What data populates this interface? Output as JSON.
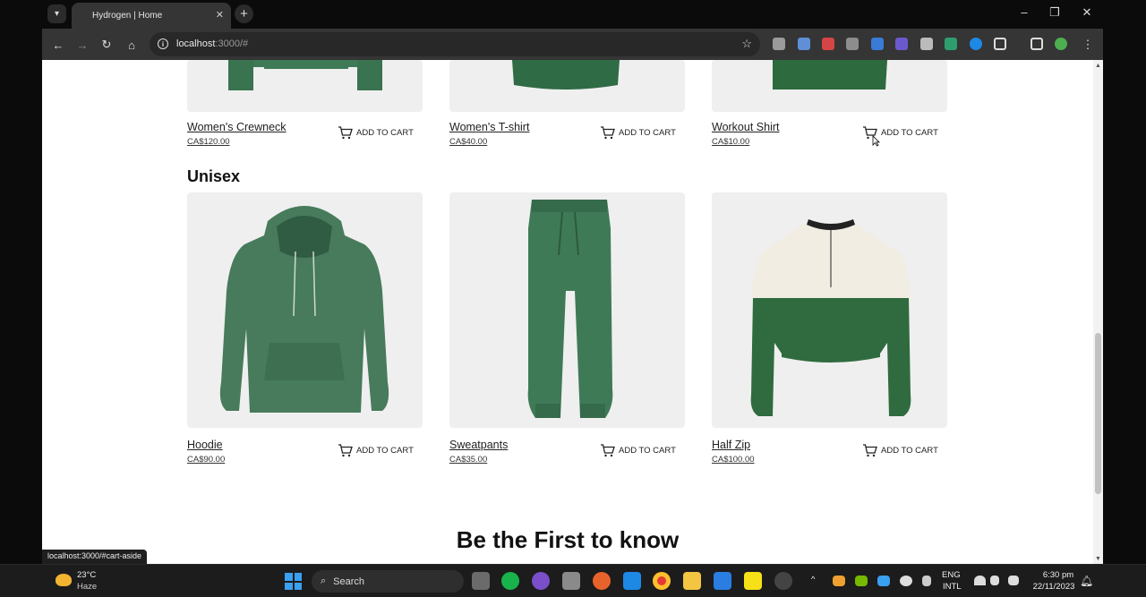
{
  "browser": {
    "tab_title": "Hydrogen | Home",
    "url_host": "localhost",
    "url_rest": ":3000/#",
    "status_tooltip": "localhost:3000/#cart-aside"
  },
  "page": {
    "top_row": [
      {
        "title": "Women's Crewneck",
        "price": "CA$120.00",
        "add_label": "ADD TO CART"
      },
      {
        "title": "Women's T-shirt",
        "price": "CA$40.00",
        "add_label": "ADD TO CART"
      },
      {
        "title": "Workout Shirt",
        "price": "CA$10.00",
        "add_label": "ADD TO CART"
      }
    ],
    "section_title": "Unisex",
    "unisex": [
      {
        "title": "Hoodie",
        "price": "CA$90.00",
        "add_label": "ADD TO CART"
      },
      {
        "title": "Sweatpants",
        "price": "CA$35.00",
        "add_label": "ADD TO CART"
      },
      {
        "title": "Half Zip",
        "price": "CA$100.00",
        "add_label": "ADD TO CART"
      }
    ],
    "newsletter_title": "Be the First to know"
  },
  "taskbar": {
    "weather_temp": "23°C",
    "weather_condition": "Haze",
    "search_label": "Search",
    "lang_top": "ENG",
    "lang_bottom": "INTL",
    "time": "6:30 pm",
    "date": "22/11/2023"
  },
  "colors": {
    "product_green": "#3f7a57",
    "dark_green": "#2f6b3e",
    "cream": "#f1ede2",
    "card_bg": "#efefef"
  }
}
